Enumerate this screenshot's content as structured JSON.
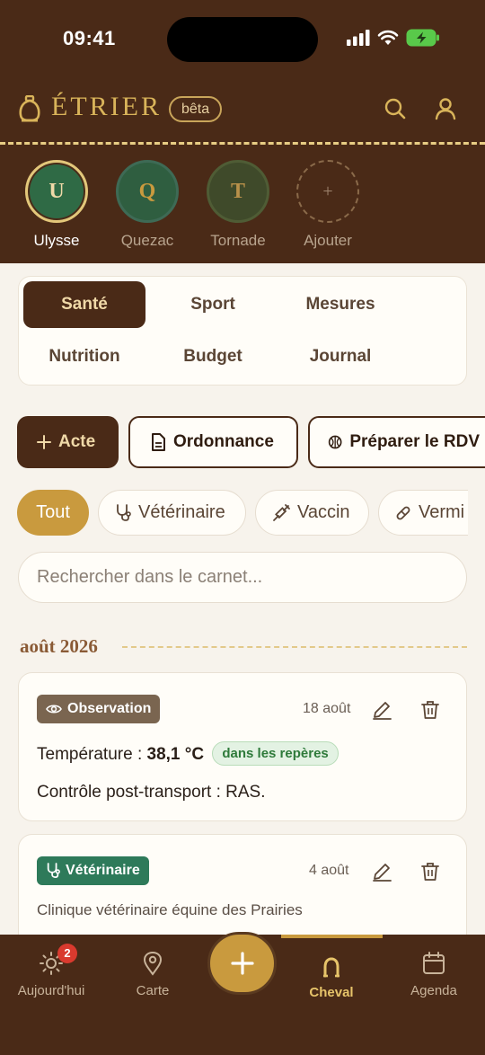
{
  "status_bar": {
    "time": "09:41"
  },
  "header": {
    "brand": "ÉTRIER",
    "beta": "bêta"
  },
  "horses": [
    {
      "initial": "U",
      "name": "Ulysse",
      "selected": true
    },
    {
      "initial": "Q",
      "name": "Quezac",
      "selected": false
    },
    {
      "initial": "T",
      "name": "Tornade",
      "selected": false
    },
    {
      "initial": "+",
      "name": "Ajouter",
      "selected": false
    }
  ],
  "tabs": [
    {
      "label": "Santé",
      "active": true
    },
    {
      "label": "Sport",
      "active": false
    },
    {
      "label": "Mesures",
      "active": false
    },
    {
      "label": "Nutrition",
      "active": false
    },
    {
      "label": "Budget",
      "active": false
    },
    {
      "label": "Journal",
      "active": false
    }
  ],
  "actions": {
    "add": "Acte",
    "prescription": "Ordonnance",
    "prepare": "Préparer le RDV"
  },
  "filters": [
    {
      "label": "Tout",
      "active": true,
      "icon": "none"
    },
    {
      "label": "Vétérinaire",
      "active": false,
      "icon": "stethoscope-icon"
    },
    {
      "label": "Vaccin",
      "active": false,
      "icon": "syringe-icon"
    },
    {
      "label": "Vermi",
      "active": false,
      "icon": "pill-icon"
    }
  ],
  "search": {
    "placeholder": "Rechercher dans le carnet..."
  },
  "month": "août 2026",
  "entries": [
    {
      "type": "Observation",
      "type_color": "#7a6550",
      "date": "18 août",
      "temperature_label": "Température : ",
      "temperature_value": "38,1 °C",
      "status": "dans les repères",
      "note": "Contrôle post-transport : RAS."
    },
    {
      "type": "Vétérinaire",
      "type_color": "#2e7a5a",
      "date": "4 août",
      "note": "Clinique vétérinaire équine des Prairies"
    }
  ],
  "nav": {
    "today": "Aujourd'hui",
    "today_badge": "2",
    "map": "Carte",
    "horse": "Cheval",
    "agenda": "Agenda"
  },
  "colors": {
    "primary": "#4a2a17",
    "accent": "#c99a3e",
    "background": "#f7f3ec"
  }
}
